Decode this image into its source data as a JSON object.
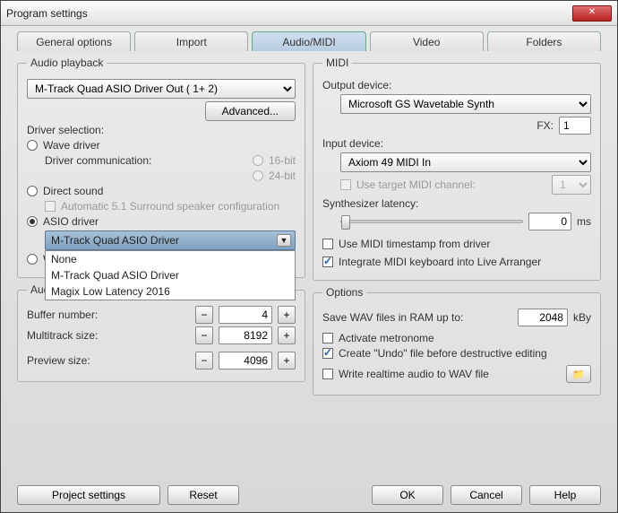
{
  "window_title": "Program settings",
  "tabs": {
    "general": "General options",
    "import": "Import",
    "audio_midi": "Audio/MIDI",
    "video": "Video",
    "folders": "Folders"
  },
  "playback": {
    "legend": "Audio playback",
    "output_select": "M-Track Quad ASIO Driver Out ( 1+ 2)",
    "advanced": "Advanced...",
    "driver_selection": "Driver selection:",
    "wave": "Wave driver",
    "driver_comm": "Driver communication:",
    "bit16": "16-bit",
    "bit24": "24-bit",
    "direct": "Direct sound",
    "auto51": "Automatic 5.1 Surround speaker configuration",
    "asio": "ASIO driver",
    "asio_select": "M-Track Quad ASIO Driver",
    "asio_options": [
      "None",
      "M-Track Quad ASIO Driver",
      "Magix Low Latency 2016"
    ],
    "wasapi": "WASAPI Driver"
  },
  "buffer": {
    "legend": "Audio buffer",
    "buffer_number": "Buffer number:",
    "buffer_number_val": "4",
    "multitrack": "Multitrack size:",
    "multitrack_val": "8192",
    "preview": "Preview size:",
    "preview_val": "4096"
  },
  "midi": {
    "legend": "MIDI",
    "out_label": "Output device:",
    "out_val": "Microsoft GS Wavetable Synth",
    "fx_label": "FX:",
    "fx_val": "1",
    "in_label": "Input device:",
    "in_val": "Axiom 49 MIDI In",
    "use_target": "Use target MIDI channel:",
    "target_val": "1",
    "synth_lat": "Synthesizer latency:",
    "synth_val": "0",
    "ms": "ms",
    "use_ts": "Use MIDI timestamp from driver",
    "integrate": "Integrate MIDI keyboard into Live Arranger"
  },
  "options": {
    "legend": "Options",
    "save_wav": "Save WAV files in RAM up to:",
    "save_wav_val": "2048",
    "kby": "kBy",
    "metronome": "Activate metronome",
    "undo": "Create \"Undo\" file before destructive editing",
    "write_rt": "Write realtime audio to WAV file"
  },
  "bottom": {
    "project": "Project settings",
    "reset": "Reset",
    "ok": "OK",
    "cancel": "Cancel",
    "help": "Help"
  }
}
